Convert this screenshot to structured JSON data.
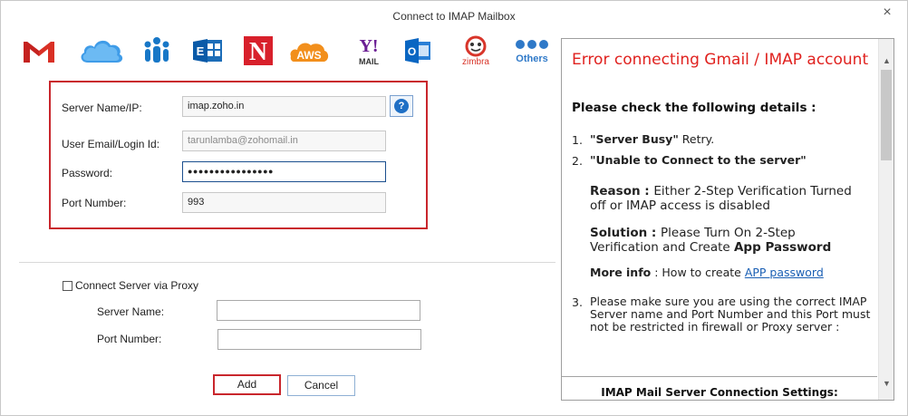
{
  "window": {
    "title": "Connect to IMAP Mailbox",
    "close_glyph": "×"
  },
  "providers": [
    {
      "name": "gmail-icon",
      "label": "M"
    },
    {
      "name": "icloud-icon",
      "label": ""
    },
    {
      "name": "lotus-notes-icon",
      "label": ""
    },
    {
      "name": "exchange-icon",
      "label": "E"
    },
    {
      "name": "netmail-icon",
      "label": "N"
    },
    {
      "name": "aws-icon",
      "label": "AWS"
    },
    {
      "name": "yahoo-mail-icon",
      "label": "Y!",
      "sub": "MAIL"
    },
    {
      "name": "outlook-icon",
      "label": "O"
    },
    {
      "name": "zimbra-icon",
      "label": "zimbra"
    },
    {
      "name": "others-icon",
      "label": "Others"
    }
  ],
  "server": {
    "server_name_label": "Server Name/IP:",
    "server_name_value": "imap.zoho.in",
    "help_glyph": "?",
    "user_email_label": "User Email/Login Id:",
    "user_email_value": "tarunlamba@zohomail.in",
    "password_label": "Password:",
    "password_value": "●●●●●●●●●●●●●●●●",
    "port_label": "Port Number:",
    "port_value": "993"
  },
  "proxy": {
    "checkbox_label": "Connect Server via Proxy",
    "server_name_label": "Server Name:",
    "server_name_value": "",
    "port_label": "Port Number:",
    "port_value": ""
  },
  "buttons": {
    "add": "Add",
    "cancel": "Cancel"
  },
  "help_panel": {
    "error_title": "Error connecting Gmail / IMAP account",
    "check_heading": "Please check the following details :",
    "item1_num": "1.",
    "item1_bold": "\"Server Busy\"",
    "item1_text": " Retry.",
    "item2_num": "2.",
    "item2_text": "\"Unable to Connect to the server\"",
    "reason_label": "Reason : ",
    "reason_text": "Either 2-Step Verification Turned off or IMAP access is disabled",
    "solution_label": "Solution : ",
    "solution_text": "Please Turn On 2-Step Verification and Create ",
    "solution_bold": "App Password",
    "moreinfo_label": "More info",
    "moreinfo_text": " : How to create ",
    "moreinfo_link": "APP password",
    "item3_num": "3.",
    "item3_text": "Please make sure you are using the correct IMAP Server name and Port Number and this Port must not be restricted in firewall or Proxy server :",
    "settings_title": "IMAP Mail Server Connection Settings:"
  },
  "scroll": {
    "up_glyph": "▲",
    "down_glyph": "▼"
  },
  "colors": {
    "accent_red": "#c9262c",
    "error_red": "#e0221f",
    "link_blue": "#1a5fb4"
  }
}
